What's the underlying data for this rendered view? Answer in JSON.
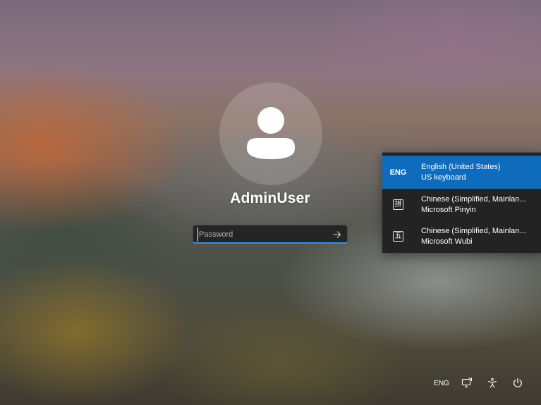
{
  "user": {
    "name": "AdminUser",
    "avatar_icon": "person-icon"
  },
  "password": {
    "placeholder": "Password",
    "value": "",
    "submit_icon": "arrow-right-icon",
    "accent_color": "#3b8fd8"
  },
  "language_menu": {
    "selected_color": "#0f6cbd",
    "items": [
      {
        "code": "ENG",
        "name": "English (United States)",
        "layout": "US keyboard",
        "selected": true
      },
      {
        "glyph": "拼",
        "name": "Chinese (Simplified, Mainlan...",
        "layout": "Microsoft Pinyin",
        "selected": false
      },
      {
        "glyph": "五",
        "name": "Chinese (Simplified, Mainlan...",
        "layout": "Microsoft Wubi",
        "selected": false
      }
    ]
  },
  "tray": {
    "language": "ENG",
    "network_icon": "network-icon",
    "accessibility_icon": "accessibility-icon",
    "power_icon": "power-icon"
  }
}
